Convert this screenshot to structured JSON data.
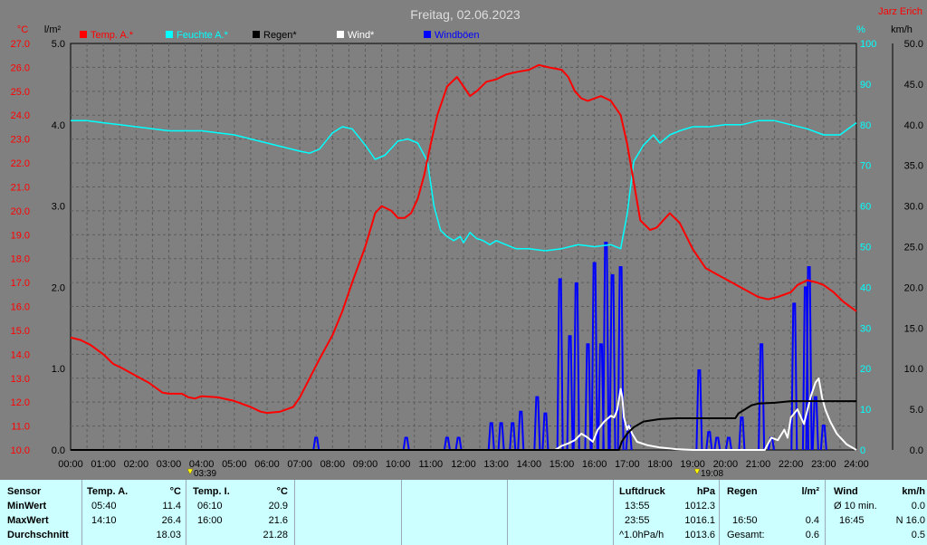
{
  "chart_data": {
    "type": "line",
    "title": "Freitag, 02.06.2023",
    "credit": "Jarz Erich",
    "legend": [
      {
        "name": "Temp. A.*",
        "color": "#ff0000"
      },
      {
        "name": "Feuchte A.*",
        "color": "#00ffff"
      },
      {
        "name": "Regen*",
        "color": "#000000"
      },
      {
        "name": "Wind*",
        "color": "#ffffff"
      },
      {
        "name": "Windböen",
        "color": "#0000ff"
      }
    ],
    "axes": {
      "temp": {
        "unit": "°C",
        "min": 10,
        "max": 27,
        "ticks": [
          "27.0",
          "26.0",
          "25.0",
          "24.0",
          "23.0",
          "22.0",
          "21.0",
          "20.0",
          "19.0",
          "18.0",
          "17.0",
          "16.0",
          "15.0",
          "14.0",
          "13.0",
          "12.0",
          "11.0",
          "10.0"
        ]
      },
      "rain": {
        "unit": "l/m²",
        "min": 0,
        "max": 5,
        "ticks": [
          "5.0",
          "4.0",
          "3.0",
          "2.0",
          "1.0",
          "0.0"
        ]
      },
      "humidity": {
        "unit": "%",
        "min": 0,
        "max": 100,
        "ticks": [
          "100",
          "90",
          "80",
          "70",
          "60",
          "50",
          "40",
          "30",
          "20",
          "10",
          "0"
        ]
      },
      "wind": {
        "unit": "km/h",
        "min": 0,
        "max": 50,
        "ticks": [
          "50.0",
          "45.0",
          "40.0",
          "35.0",
          "30.0",
          "25.0",
          "20.0",
          "15.0",
          "10.0",
          "5.0",
          "0.0"
        ]
      },
      "x": {
        "min": 0,
        "max": 24,
        "ticks": [
          "00:00",
          "01:00",
          "02:00",
          "03:00",
          "04:00",
          "05:00",
          "06:00",
          "07:00",
          "08:00",
          "09:00",
          "10:00",
          "11:00",
          "12:00",
          "13:00",
          "14:00",
          "15:00",
          "16:00",
          "17:00",
          "18:00",
          "19:00",
          "20:00",
          "21:00",
          "22:00",
          "23:00",
          "24:00"
        ]
      }
    },
    "sun": {
      "sunrise": "03:39",
      "sunset": "19:08"
    },
    "grid": true,
    "series": [
      {
        "name": "Temp. A.*",
        "color": "#ff0000",
        "axis": "temp",
        "x": [
          0,
          0.3,
          0.6,
          1,
          1.3,
          1.6,
          2,
          2.4,
          2.8,
          3,
          3.4,
          3.6,
          3.8,
          4,
          4.5,
          5,
          5.5,
          5.8,
          6,
          6.4,
          6.8,
          7,
          7.3,
          7.6,
          8,
          8.3,
          8.6,
          9,
          9.3,
          9.5,
          9.8,
          10,
          10.2,
          10.4,
          10.6,
          10.8,
          11,
          11.2,
          11.5,
          11.8,
          12,
          12.2,
          12.4,
          12.7,
          13,
          13.3,
          13.6,
          14,
          14.3,
          14.6,
          15,
          15.2,
          15.4,
          15.6,
          15.8,
          16,
          16.2,
          16.5,
          16.8,
          17,
          17.2,
          17.4,
          17.7,
          17.9,
          18.1,
          18.3,
          18.6,
          19,
          19.4,
          19.8,
          20.2,
          20.6,
          21,
          21.3,
          21.6,
          22,
          22.2,
          22.5,
          22.8,
          23,
          23.3,
          23.6,
          24
        ],
        "y": [
          14.7,
          14.6,
          14.4,
          14.0,
          13.6,
          13.4,
          13.1,
          12.8,
          12.4,
          12.35,
          12.35,
          12.2,
          12.15,
          12.25,
          12.2,
          12.05,
          11.8,
          11.6,
          11.55,
          11.6,
          11.8,
          12.2,
          13.0,
          13.8,
          14.8,
          15.8,
          17.0,
          18.5,
          19.9,
          20.2,
          20.0,
          19.7,
          19.7,
          19.9,
          20.5,
          21.5,
          22.8,
          24.0,
          25.2,
          25.6,
          25.2,
          24.8,
          25.0,
          25.4,
          25.5,
          25.7,
          25.8,
          25.9,
          26.1,
          26.0,
          25.9,
          25.6,
          25.0,
          24.7,
          24.6,
          24.7,
          24.8,
          24.6,
          24.0,
          22.8,
          21.2,
          19.6,
          19.2,
          19.3,
          19.6,
          19.9,
          19.5,
          18.4,
          17.6,
          17.3,
          17.0,
          16.7,
          16.4,
          16.3,
          16.4,
          16.6,
          16.9,
          17.1,
          17.0,
          16.9,
          16.6,
          16.2,
          15.8
        ]
      },
      {
        "name": "Feuchte A.*",
        "color": "#00ffff",
        "axis": "humidity",
        "x": [
          0,
          0.5,
          1,
          1.5,
          2,
          2.5,
          3,
          3.5,
          4,
          4.5,
          5,
          5.5,
          6,
          6.5,
          7,
          7.3,
          7.6,
          8,
          8.3,
          8.6,
          9,
          9.3,
          9.6,
          10,
          10.3,
          10.6,
          10.9,
          11.1,
          11.3,
          11.5,
          11.7,
          11.9,
          12,
          12.2,
          12.4,
          12.6,
          12.8,
          13,
          13.3,
          13.6,
          14,
          14.5,
          15,
          15.5,
          16,
          16.5,
          16.8,
          17,
          17.2,
          17.5,
          17.8,
          18,
          18.3,
          18.6,
          19,
          19.5,
          20,
          20.5,
          21,
          21.5,
          22,
          22.5,
          23,
          23.5,
          24
        ],
        "y": [
          81,
          81,
          80.5,
          80,
          79.5,
          79,
          78.5,
          78.5,
          78.5,
          78,
          77.5,
          76.5,
          75.5,
          74.5,
          73.5,
          73,
          74,
          78,
          79.5,
          79,
          75,
          71.5,
          72.5,
          76,
          76.5,
          75.5,
          71,
          60,
          54,
          52.5,
          51.5,
          52.5,
          51,
          53.5,
          52,
          51.5,
          50.5,
          51.5,
          50.5,
          49.5,
          49.5,
          49,
          49.5,
          50.5,
          50,
          50.5,
          49.5,
          58,
          71,
          75,
          77.5,
          75.5,
          77.5,
          78.5,
          79.5,
          79.5,
          80,
          80,
          81,
          81,
          80,
          79,
          77.5,
          77.5,
          80.5
        ]
      },
      {
        "name": "Regen*",
        "color": "#000000",
        "axis": "rain",
        "x": [
          0,
          16.75,
          16.83,
          17,
          17.2,
          17.5,
          18,
          18.5,
          19,
          19.5,
          20,
          20.3,
          20.4,
          20.6,
          20.8,
          21,
          21.5,
          22,
          23,
          24
        ],
        "y": [
          0,
          0,
          0.1,
          0.2,
          0.28,
          0.35,
          0.38,
          0.39,
          0.39,
          0.39,
          0.39,
          0.39,
          0.45,
          0.5,
          0.55,
          0.57,
          0.58,
          0.6,
          0.6,
          0.6
        ]
      },
      {
        "name": "Wind*",
        "color": "#ffffff",
        "axis": "wind",
        "x": [
          0,
          14.8,
          15,
          15.2,
          15.4,
          15.6,
          15.8,
          15.95,
          16.1,
          16.3,
          16.5,
          16.6,
          16.7,
          16.8,
          16.85,
          16.9,
          17.0,
          17.05,
          17.15,
          17.3,
          17.6,
          18,
          18.5,
          19,
          21.2,
          21.4,
          21.6,
          21.8,
          21.9,
          22.0,
          22.2,
          22.4,
          22.6,
          22.75,
          22.85,
          22.95,
          23.05,
          23.2,
          23.4,
          23.7,
          24
        ],
        "y": [
          0,
          0,
          0.5,
          0.8,
          1.2,
          2.0,
          1.5,
          1.0,
          2.5,
          3.5,
          4.2,
          4.0,
          5.0,
          7.5,
          6.5,
          4.0,
          2.5,
          3.0,
          2.0,
          1.0,
          0.6,
          0.3,
          0.1,
          0,
          0,
          1.5,
          1.2,
          2.5,
          1.5,
          4.0,
          5.0,
          3.2,
          6.5,
          8.3,
          8.8,
          6.5,
          5.0,
          3.5,
          2.0,
          0.7,
          0
        ]
      }
    ],
    "gust_spikes": [
      {
        "x": 7.5,
        "y": 1.5
      },
      {
        "x": 10.25,
        "y": 1.5
      },
      {
        "x": 11.5,
        "y": 1.5
      },
      {
        "x": 11.85,
        "y": 1.5
      },
      {
        "x": 12.85,
        "y": 3.3
      },
      {
        "x": 13.15,
        "y": 3.3
      },
      {
        "x": 13.5,
        "y": 3.3
      },
      {
        "x": 13.75,
        "y": 4.7
      },
      {
        "x": 14.25,
        "y": 6.5
      },
      {
        "x": 14.5,
        "y": 4.5
      },
      {
        "x": 14.95,
        "y": 21
      },
      {
        "x": 15.25,
        "y": 14
      },
      {
        "x": 15.45,
        "y": 20.5
      },
      {
        "x": 15.8,
        "y": 13
      },
      {
        "x": 16.0,
        "y": 23
      },
      {
        "x": 16.2,
        "y": 13
      },
      {
        "x": 16.35,
        "y": 25.5
      },
      {
        "x": 16.55,
        "y": 21.5
      },
      {
        "x": 16.8,
        "y": 22.5
      },
      {
        "x": 17.05,
        "y": 3.0
      },
      {
        "x": 19.2,
        "y": 9.8
      },
      {
        "x": 19.5,
        "y": 2.2
      },
      {
        "x": 19.75,
        "y": 1.5
      },
      {
        "x": 20.1,
        "y": 1.5
      },
      {
        "x": 20.5,
        "y": 4.0
      },
      {
        "x": 21.1,
        "y": 13.0
      },
      {
        "x": 21.4,
        "y": 1.5
      },
      {
        "x": 22.1,
        "y": 18.0
      },
      {
        "x": 22.45,
        "y": 20.0
      },
      {
        "x": 22.55,
        "y": 22.5
      },
      {
        "x": 22.75,
        "y": 6.5
      },
      {
        "x": 23.0,
        "y": 3.0
      }
    ]
  },
  "summary": {
    "labels": {
      "sensor": "Sensor",
      "min": "MinWert",
      "max": "MaxWert",
      "avg": "Durchschnitt"
    },
    "temp_a": {
      "title": "Temp. A.",
      "unit": "°C",
      "min_time": "05:40",
      "min_val": "11.4",
      "max_time": "14:10",
      "max_val": "26.4",
      "avg": "18.03"
    },
    "temp_i": {
      "title": "Temp. I.",
      "unit": "°C",
      "min_time": "06:10",
      "min_val": "20.9",
      "max_time": "16:00",
      "max_val": "21.6",
      "avg": "21.28"
    },
    "pressure": {
      "title": "Luftdruck",
      "unit": "hPa",
      "min_time": "13:55",
      "min_val": "1012.3",
      "max_time": "23:55",
      "max_val": "1016.1",
      "trend_label": "^1.0hPa/h",
      "trend_val": "1013.6"
    },
    "rain": {
      "title": "Regen",
      "unit": "l/m²",
      "max_time": "16:50",
      "max_val": "0.4",
      "total_label": "Gesamt:",
      "total_val": "0.6"
    },
    "wind": {
      "title": "Wind",
      "unit": "km/h",
      "min_label": "Ø 10 min.",
      "min_val": "0.0",
      "max_time": "16:45",
      "max_val": "N 16.0",
      "avg": "0.5"
    }
  }
}
